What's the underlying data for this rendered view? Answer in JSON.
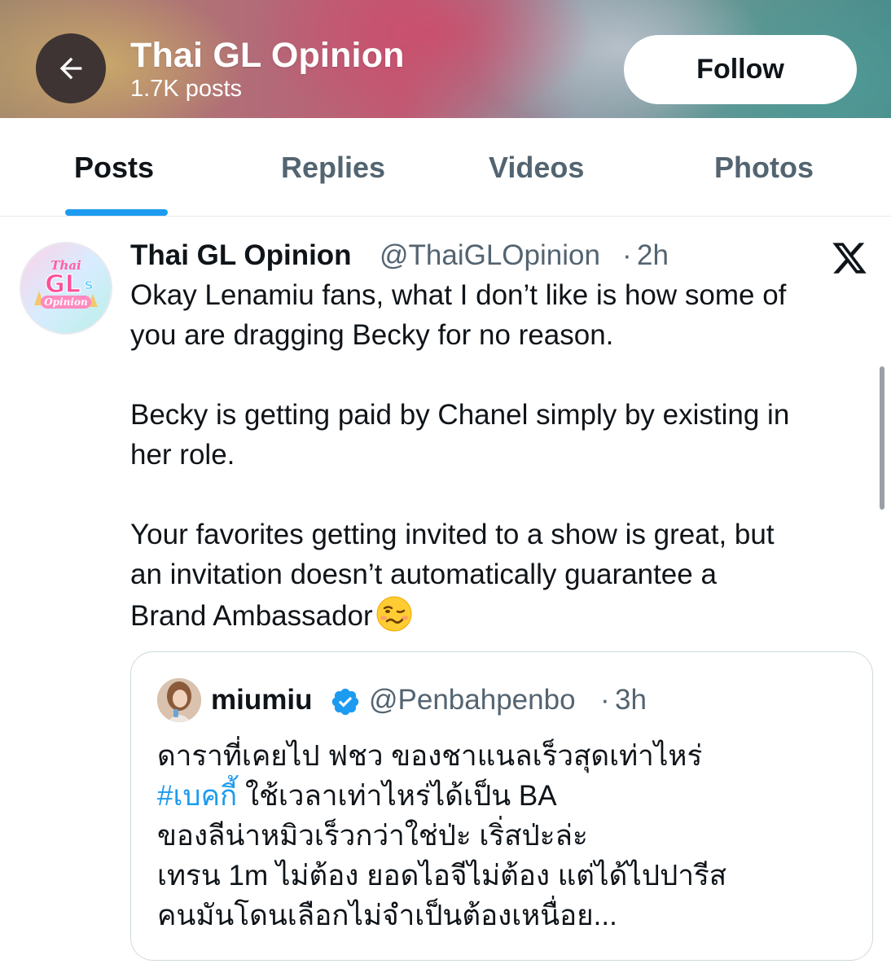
{
  "header": {
    "title": "Thai GL Opinion",
    "posts_count": "1.7K posts",
    "follow_label": "Follow"
  },
  "tabs": [
    {
      "label": "Posts",
      "active": true
    },
    {
      "label": "Replies",
      "active": false
    },
    {
      "label": "Videos",
      "active": false
    },
    {
      "label": "Photos",
      "active": false
    }
  ],
  "post": {
    "author_name": "Thai GL Opinion",
    "handle": "@ThaiGLOpinion",
    "separator": "·",
    "time": "2h",
    "avatar_logo_text": "Thai GL Opinion",
    "lines": [
      "Okay Lenamiu fans, what I don’t like is how some of",
      "you are dragging Becky for no reason.",
      "Becky is getting paid by Chanel simply by existing in",
      "her role.",
      "Your favorites getting invited to a show is great, but",
      "an invitation doesn’t automatically guarantee a",
      "Brand Ambassador"
    ],
    "emoji": "woozy-face-emoji"
  },
  "quote": {
    "author_name": "miumiu",
    "handle": "@Penbahpenbo",
    "separator": "·",
    "time": "3h",
    "line1": "ดาราที่เคยไป ฟชว ของชาแนลเร็วสุดเท่าไหร่",
    "hashtag": "#เบคกี้",
    "line2_rest": " ใช้เวลาเท่าไหร่ได้เป็น BA",
    "line3": "ของลีน่าหมิวเร็วกว่าใช่ป่ะ เริ่สป่ะล่ะ",
    "line4": "เทรน 1m ไม่ต้อง ยอดไอจีไม่ต้อง แต่ได้ไปปารีส",
    "line5": "คนมันโดนเลือกไม่จำเป็นต้องเหนื่อย..."
  },
  "colors": {
    "accent": "#1d9bf0",
    "text_primary": "#0f1419",
    "text_secondary": "#536471"
  }
}
